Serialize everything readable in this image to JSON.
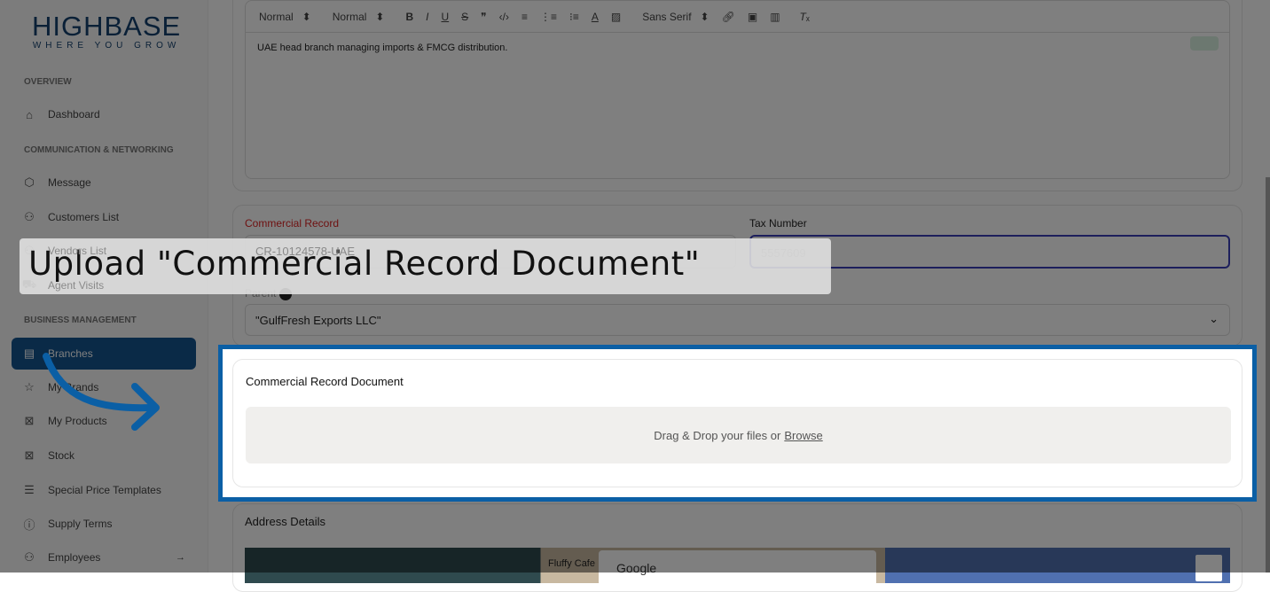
{
  "brand": {
    "name": "HIGHBASE",
    "tagline": "WHERE YOU GROW"
  },
  "sidebar": {
    "sections": [
      "OVERVIEW",
      "COMMUNICATION & NETWORKING",
      "BUSINESS MANAGEMENT"
    ],
    "items": [
      {
        "label": "Dashboard",
        "icon": "home-icon"
      },
      {
        "label": "Message",
        "icon": "box-icon"
      },
      {
        "label": "Customers List",
        "icon": "users-icon"
      },
      {
        "label": "Vendors List",
        "icon": "users-icon"
      },
      {
        "label": "Agent Visits",
        "icon": "truck-icon"
      },
      {
        "label": "Branches",
        "icon": "store-icon"
      },
      {
        "label": "My Brands",
        "icon": "star-icon"
      },
      {
        "label": "My Products",
        "icon": "archive-icon"
      },
      {
        "label": "Stock",
        "icon": "archive-icon"
      },
      {
        "label": "Special Price Templates",
        "icon": "list-icon"
      },
      {
        "label": "Supply Terms",
        "icon": "info-icon"
      },
      {
        "label": "Employees",
        "icon": "team-icon"
      }
    ]
  },
  "editor": {
    "toolbar": {
      "header": "Normal",
      "size": "Normal",
      "font": "Sans Serif"
    },
    "content": "UAE head branch managing imports & FMCG distribution."
  },
  "form": {
    "commercial_record_label": "Commercial Record",
    "commercial_record_value": "CR-10124578-UAE",
    "tax_label": "Tax Number",
    "tax_value": "5557609",
    "parent_label": "Parent",
    "parent_value": "\"GulfFresh Exports LLC\"",
    "doc_title": "Commercial Record Document",
    "drop_text": "Drag & Drop your files or",
    "browse": "Browse",
    "address_title": "Address Details"
  },
  "map": {
    "place": "Fluffy Cafe",
    "google": "Google"
  },
  "caption": "Upload \"Commercial Record Document\"",
  "colors": {
    "accent": "#0b5fa5",
    "active": "#14548f"
  }
}
